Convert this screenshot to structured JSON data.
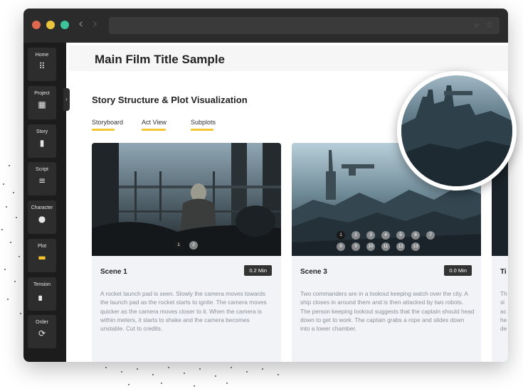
{
  "window": {
    "controls": [
      "close",
      "minimize",
      "maximize"
    ]
  },
  "browser": {
    "back_icon": "chevron-left-icon",
    "forward_icon": "chevron-right-icon",
    "search_icon": "search-icon",
    "bookmark_icon": "star-icon",
    "back_glyph": "‹",
    "forward_glyph": "›",
    "search_glyph": "⌕",
    "star_glyph": "☆"
  },
  "sidebar": {
    "collapse_glyph": "›",
    "items": [
      {
        "label": "Home",
        "icon": "grid-icon",
        "glyph": "⠿"
      },
      {
        "label": "Project",
        "icon": "dashboard-icon",
        "glyph": "▦"
      },
      {
        "label": "Story",
        "icon": "bookmark-icon",
        "glyph": "▮"
      },
      {
        "label": "Script",
        "icon": "lines-icon",
        "glyph": "≡"
      },
      {
        "label": "Character",
        "icon": "person-icon",
        "glyph": "●"
      },
      {
        "label": "Plot",
        "icon": "book-icon",
        "glyph": "▬"
      },
      {
        "label": "Tension",
        "icon": "bar-chart-icon",
        "glyph": "▖"
      },
      {
        "label": "Order",
        "icon": "shuffle-icon",
        "glyph": "⟳"
      }
    ]
  },
  "header": {
    "film_title": "Main Film Title Sample"
  },
  "section": {
    "title": "Story Structure & Plot Visualization"
  },
  "tabs": [
    {
      "label": "Storyboard"
    },
    {
      "label": "Act View"
    },
    {
      "label": "Subplots"
    }
  ],
  "cards": [
    {
      "scene": "Scene 1",
      "duration": "0.2 Min",
      "description": "A rocket launch pad is seen. Slowly the camera moves towards the launch pad as the rocket starts to ignite. The camera moves quicker as the camera moves closer to it. When the camera is within meters, it starts to shake and the camera becomes unstable. Cut to credits.",
      "pages": [
        "1",
        "2"
      ],
      "active_page": "1"
    },
    {
      "scene": "Scene 3",
      "duration": "0.0 Min",
      "description": "Two commanders are in a lookout keeping watch over the city. A ship closes in around them and is then attacked by two robots. The person keeping lookout suggests that the captain should head down to get to work. The captain grabs a rope and slides down into a lower chamber.",
      "pages": [
        "1",
        "2",
        "3",
        "4",
        "5",
        "6",
        "7",
        "8",
        "9",
        "10",
        "11",
        "12",
        "13"
      ],
      "active_page": "1"
    }
  ],
  "partial_card": {
    "scene_fragment": "Ti",
    "description_fragments": [
      "Th",
      "sl",
      "ac",
      "he",
      "de"
    ]
  },
  "colors": {
    "accent": "#f2c531",
    "sidebar_bg": "#1c1c1c",
    "titlebar_bg": "#2b2b2b"
  }
}
